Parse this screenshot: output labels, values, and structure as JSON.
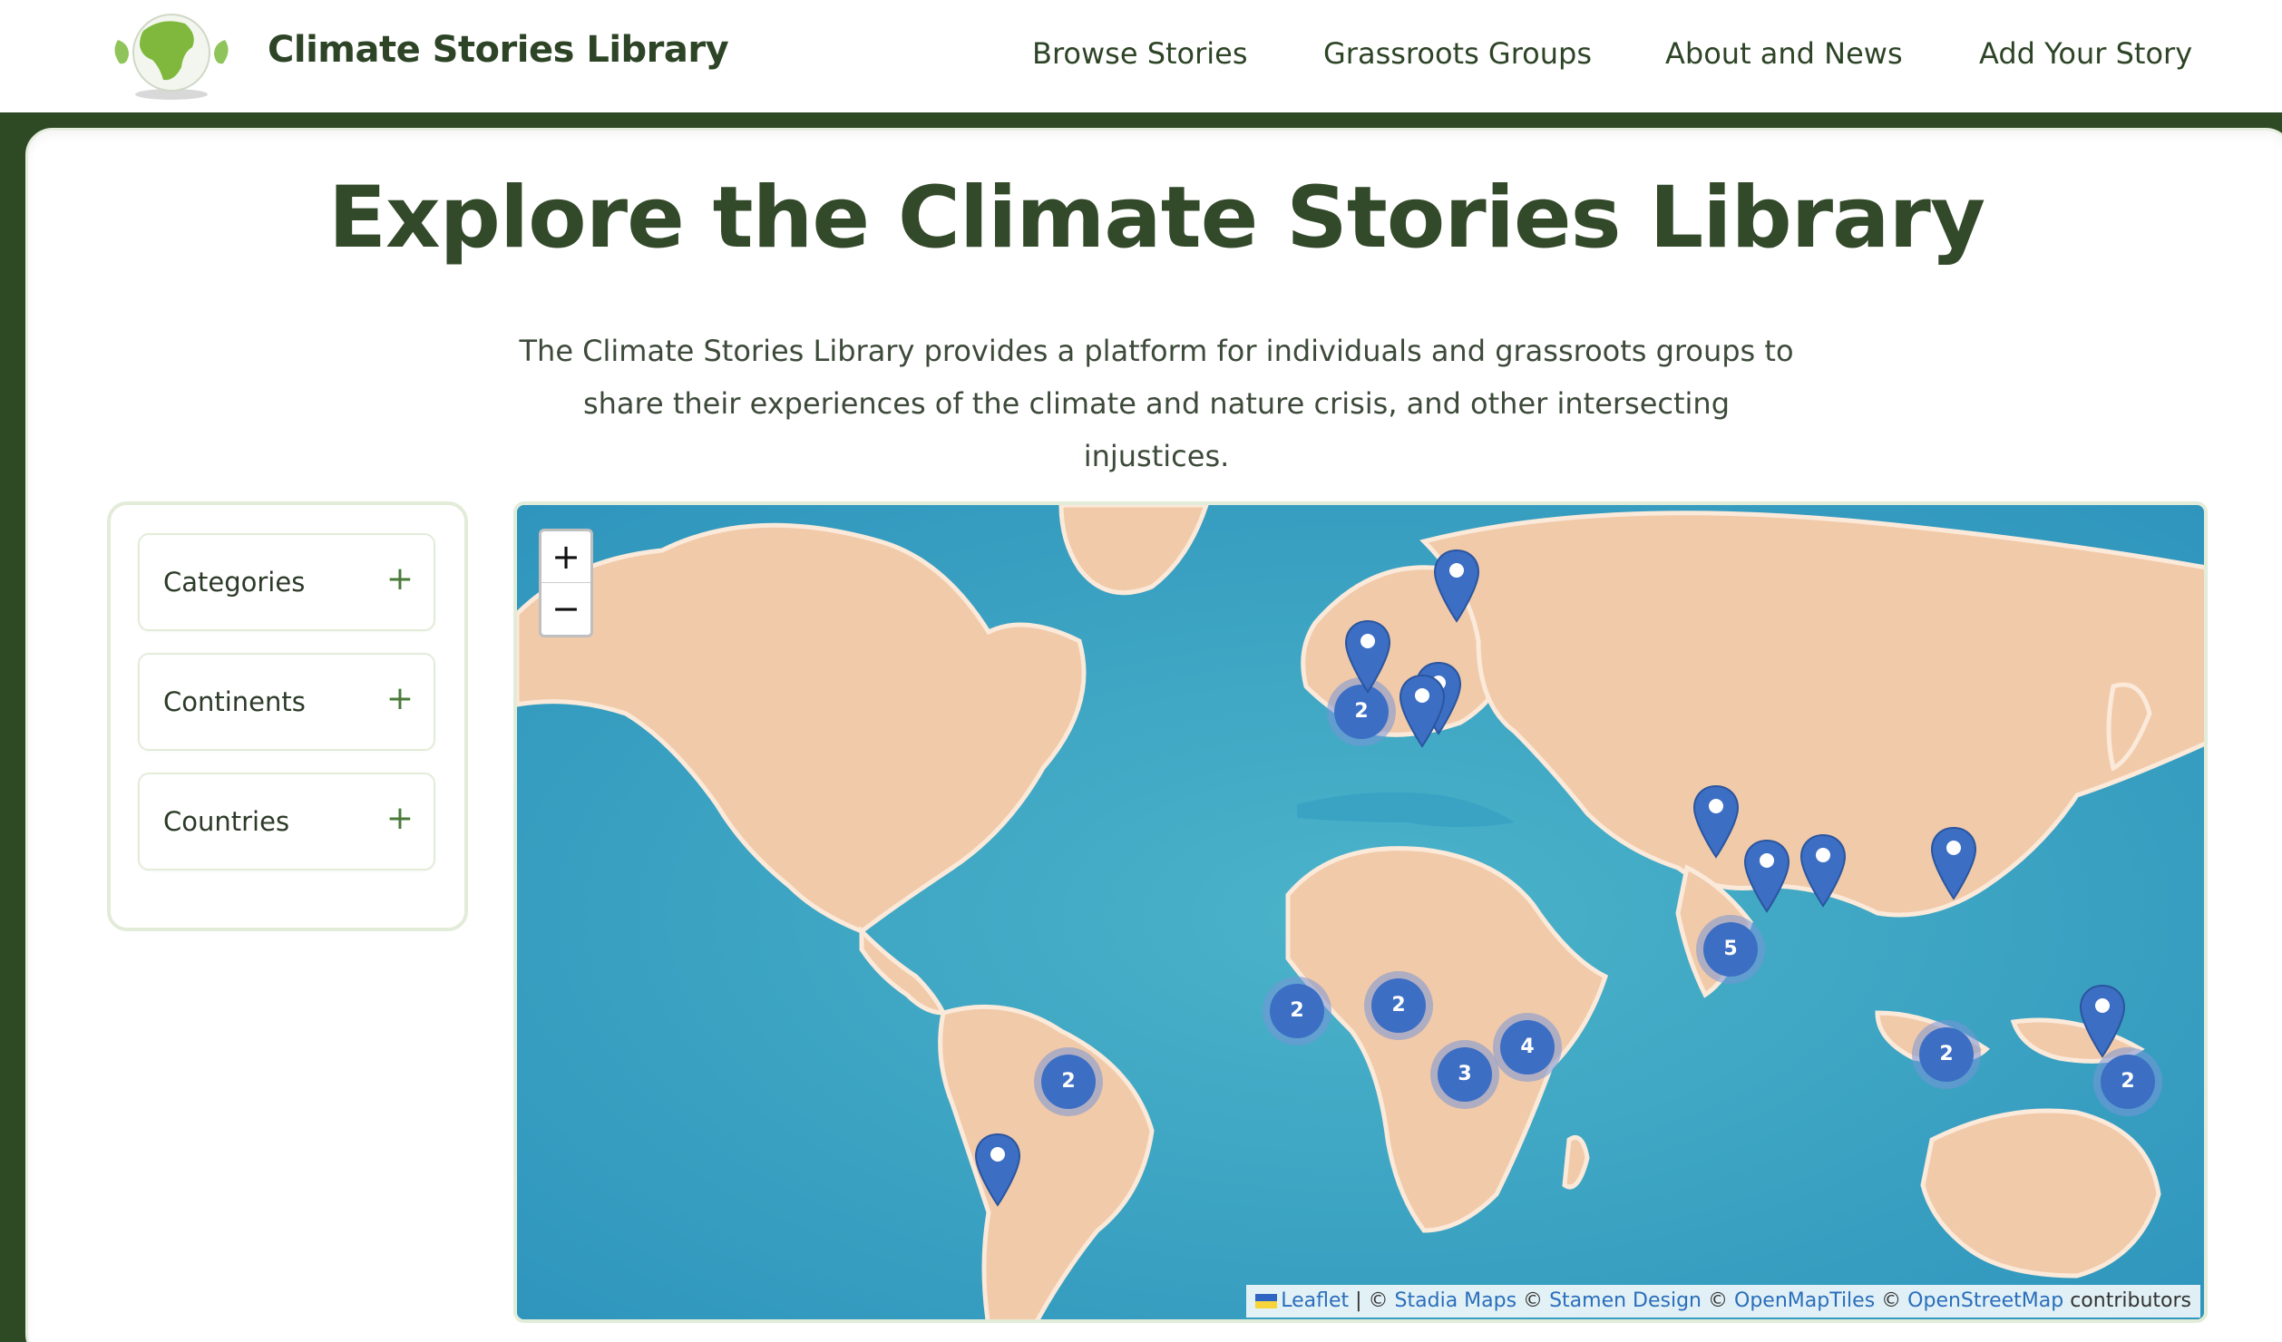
{
  "header": {
    "brand": "Climate Stories Library",
    "nav": [
      "Browse Stories",
      "Grassroots Groups",
      "About and News",
      "Add Your Story"
    ]
  },
  "main": {
    "title": "Explore the Climate Stories Library",
    "intro_line1": "The Climate Stories Library provides a platform for individuals and grassroots groups to",
    "intro_line2": "share their experiences of the climate and nature crisis, and other intersecting injustices."
  },
  "filters": [
    {
      "label": "Categories",
      "icon": "plus-icon",
      "symbol": "+"
    },
    {
      "label": "Continents",
      "icon": "plus-icon",
      "symbol": "+"
    },
    {
      "label": "Countries",
      "icon": "plus-icon",
      "symbol": "+"
    }
  ],
  "map": {
    "zoom_in": "+",
    "zoom_out": "−",
    "clusters": [
      "2",
      "2",
      "2",
      "3",
      "4",
      "5",
      "2",
      "2",
      "2"
    ],
    "attribution": {
      "leaflet": "Leaflet",
      "sep": " | © ",
      "stadia": "Stadia Maps",
      "c1": " © ",
      "stamen": "Stamen Design",
      "c2": " © ",
      "omt": "OpenMapTiles",
      "c3": " © ",
      "osm": "OpenStreetMap",
      "contrib": " contributors"
    }
  },
  "colors": {
    "brand_green": "#2e4a25",
    "marker_blue": "#3c6ec4",
    "ocean": "#3aa3c4",
    "land": "#f0c8a8"
  }
}
